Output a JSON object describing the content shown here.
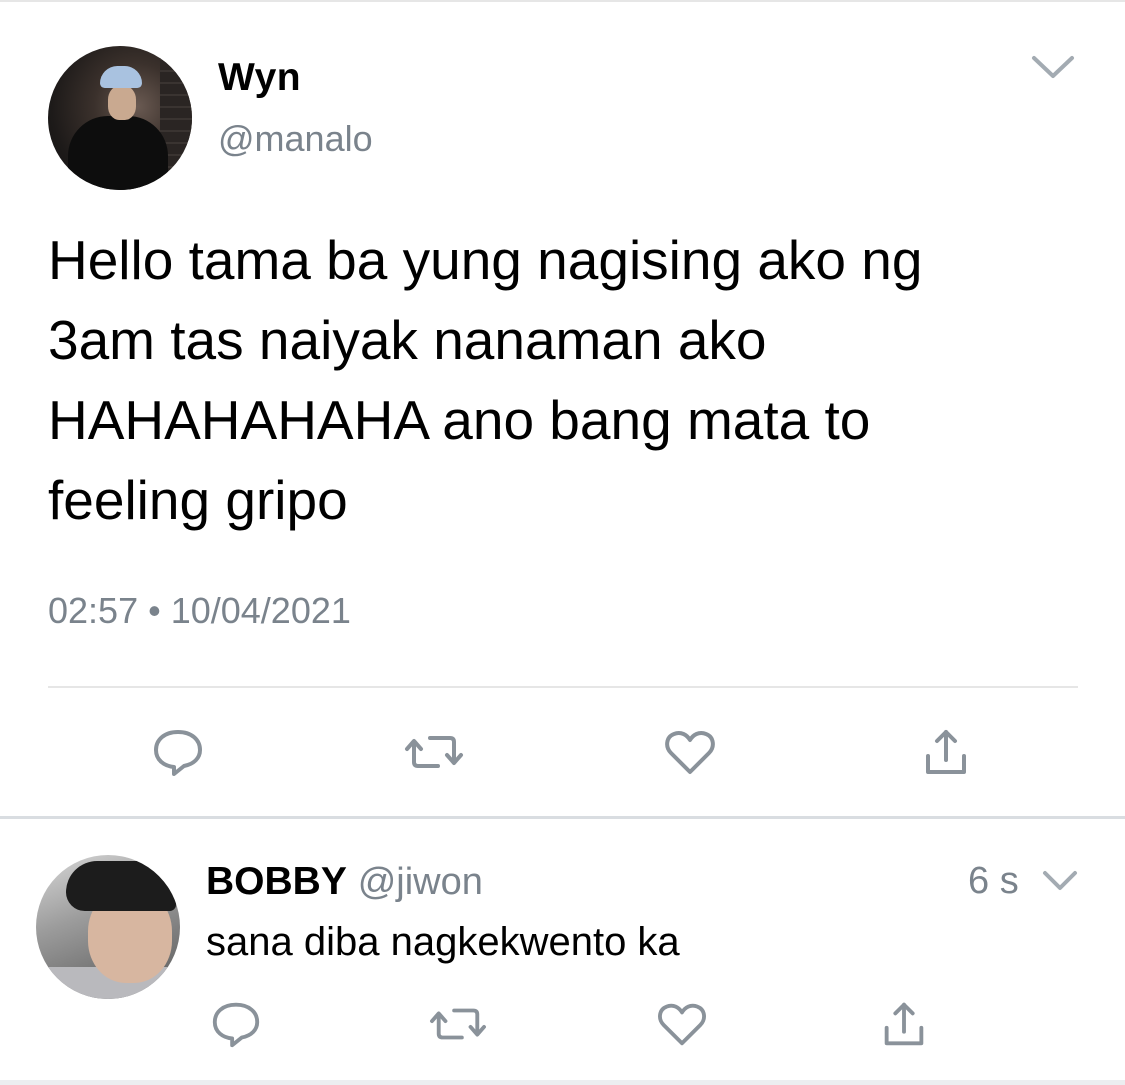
{
  "main_tweet": {
    "display_name": "Wyn",
    "handle": "@manalo",
    "text": "Hello tama ba yung nagising ako ng\n3am tas naiyak nanaman ako\nHAHAHAHAHA ano bang mata to\nfeeling gripo",
    "time": "02:57",
    "separator": "•",
    "date": "10/04/2021",
    "actions": [
      "reply-icon",
      "retweet-icon",
      "like-icon",
      "share-icon"
    ]
  },
  "reply": {
    "display_name": "BOBBY",
    "handle": "@jiwon",
    "time_ago": "6 s",
    "text": "sana diba nagkekwento ka",
    "actions": [
      "reply-icon",
      "retweet-icon",
      "like-icon",
      "share-icon"
    ]
  },
  "colors": {
    "text": "#000000",
    "secondary": "#7a838c",
    "icon": "#8a929a",
    "divider": "#e6e6e6"
  }
}
